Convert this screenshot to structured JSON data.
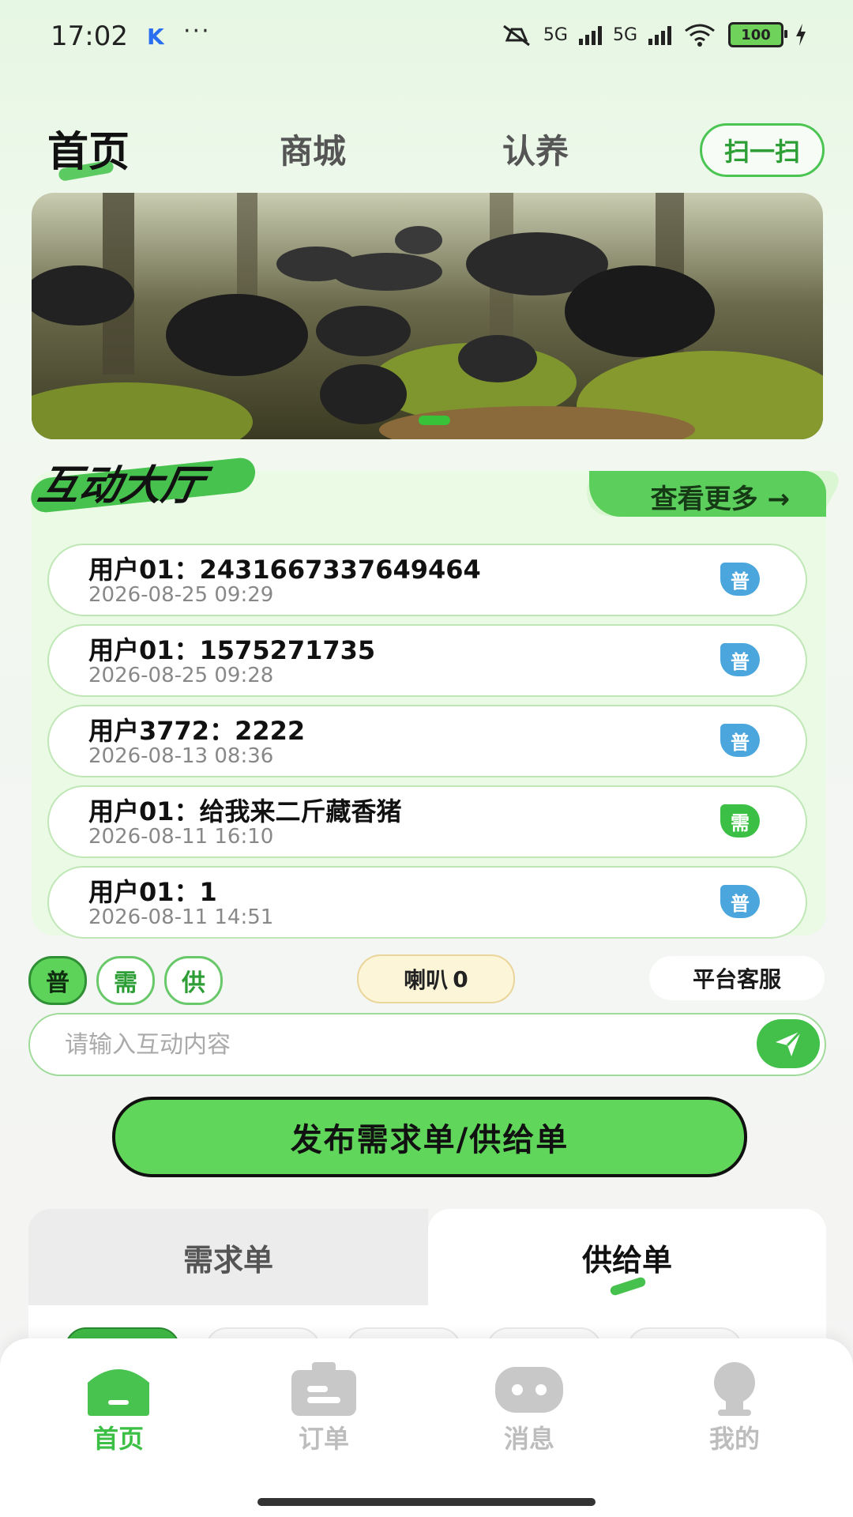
{
  "status_bar": {
    "time": "17:02",
    "app_indicator": "K",
    "more": "···",
    "net1": "5G",
    "net2": "5G",
    "battery": "100"
  },
  "top_nav": {
    "tabs": [
      "首页",
      "商城",
      "认养"
    ],
    "scan_label": "扫一扫"
  },
  "hall": {
    "title": "互动大厅",
    "more_label": "查看更多 →",
    "messages": [
      {
        "text": "用户01：2431667337649464",
        "time": "2026-08-25 09:29",
        "badge": "普",
        "badge_color": "#4aa6dc"
      },
      {
        "text": "用户01：1575271735",
        "time": "2026-08-25 09:28",
        "badge": "普",
        "badge_color": "#4aa6dc"
      },
      {
        "text": "用户3772：2222",
        "time": "2026-08-13 08:36",
        "badge": "普",
        "badge_color": "#4aa6dc"
      },
      {
        "text": "用户01：给我来二斤藏香猪",
        "time": "2026-08-11 16:10",
        "badge": "需",
        "badge_color": "#3cbf45"
      },
      {
        "text": "用户01：1",
        "time": "2026-08-11 14:51",
        "badge": "普",
        "badge_color": "#4aa6dc"
      }
    ]
  },
  "toolbar": {
    "chips": [
      "普",
      "需",
      "供"
    ],
    "horn_label": "喇叭",
    "horn_count": "0",
    "service_label": "平台客服"
  },
  "input": {
    "placeholder": "请输入互动内容"
  },
  "publish_label": "发布需求单/供给单",
  "demand_tabs": {
    "left": "需求单",
    "right": "供给单"
  },
  "bottom_nav": [
    "首页",
    "订单",
    "消息",
    "我的"
  ],
  "colors": {
    "accent": "#4bc552",
    "badge_blue": "#4aa6dc"
  }
}
